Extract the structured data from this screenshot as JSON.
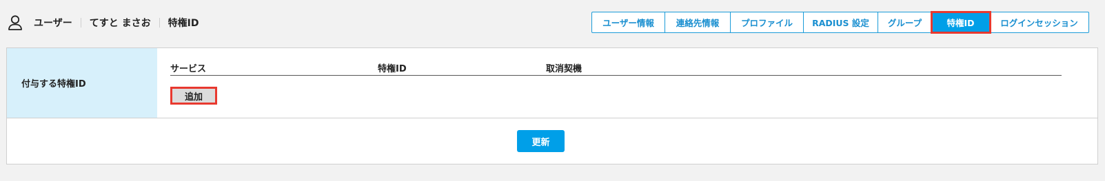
{
  "breadcrumb": {
    "icon": "user-icon",
    "items": [
      "ユーザー",
      "てすと まさお",
      "特権ID"
    ]
  },
  "tabs": [
    {
      "label": "ユーザー情報",
      "active": false
    },
    {
      "label": "連絡先情報",
      "active": false
    },
    {
      "label": "プロファイル",
      "active": false
    },
    {
      "label": "RADIUS 設定",
      "active": false
    },
    {
      "label": "グループ",
      "active": false
    },
    {
      "label": "特権ID",
      "active": true
    },
    {
      "label": "ログインセッション",
      "active": false
    }
  ],
  "form": {
    "label": "付与する特権ID",
    "columns": [
      "サービス",
      "特権ID",
      "取消契機"
    ],
    "add_label": "追加"
  },
  "update_label": "更新",
  "colors": {
    "accent": "#009fe8",
    "label_bg": "#d7f0fb",
    "highlight": "#e8392f"
  }
}
